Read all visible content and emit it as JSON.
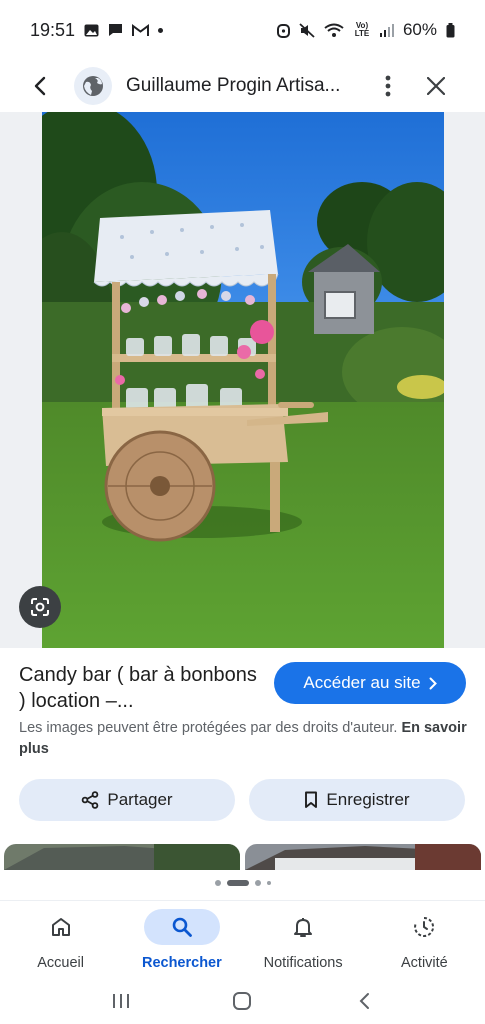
{
  "status_bar": {
    "time": "19:51",
    "battery": "60%",
    "network": "Vo) LTE"
  },
  "app_bar": {
    "site_title": "Guillaume Progin Artisa..."
  },
  "result": {
    "title": "Candy bar ( bar à bonbons ) location –...",
    "visit_button": "Accéder au site",
    "copyright_text": "Les images peuvent être protégées par des droits d'auteur.",
    "learn_more": "En savoir plus"
  },
  "actions": {
    "share_label": "Partager",
    "save_label": "Enregistrer"
  },
  "bottom_nav": {
    "items": [
      {
        "label": "Accueil",
        "icon": "home-icon"
      },
      {
        "label": "Rechercher",
        "icon": "search-icon"
      },
      {
        "label": "Notifications",
        "icon": "bell-icon"
      },
      {
        "label": "Activité",
        "icon": "activity-icon"
      }
    ],
    "active_index": 1
  },
  "colors": {
    "accent": "#1a73e8",
    "pill_bg": "#e3ebf8",
    "nav_active_bg": "#d3e3fd"
  }
}
